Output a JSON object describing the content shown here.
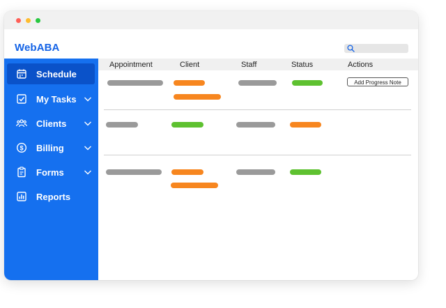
{
  "app": {
    "logo": "WebABA"
  },
  "sidebar": {
    "items": [
      {
        "label": "Schedule",
        "icon": "calendar-icon",
        "active": true,
        "expandable": false
      },
      {
        "label": "My Tasks",
        "icon": "checkbox-icon",
        "active": false,
        "expandable": true
      },
      {
        "label": "Clients",
        "icon": "users-icon",
        "active": false,
        "expandable": true
      },
      {
        "label": "Billing",
        "icon": "dollar-circle-icon",
        "active": false,
        "expandable": true
      },
      {
        "label": "Forms",
        "icon": "clipboard-icon",
        "active": false,
        "expandable": true
      },
      {
        "label": "Reports",
        "icon": "bar-chart-icon",
        "active": false,
        "expandable": false
      }
    ]
  },
  "table": {
    "headers": {
      "appointment": "Appointment",
      "client": "Client",
      "staff": "Staff",
      "status": "Status",
      "actions": "Actions"
    },
    "rows": [
      {
        "status_color": "green",
        "action_label": "Add Progress Note"
      },
      {
        "status_color": "orange"
      },
      {
        "status_color": "green"
      }
    ]
  },
  "colors": {
    "brand": "#1463e6",
    "sidebar": "#1570ef",
    "sidebar_active": "#0a52c9",
    "placeholder_gray": "#9a9a9a",
    "placeholder_orange": "#f7861f",
    "placeholder_green": "#5ec130"
  }
}
